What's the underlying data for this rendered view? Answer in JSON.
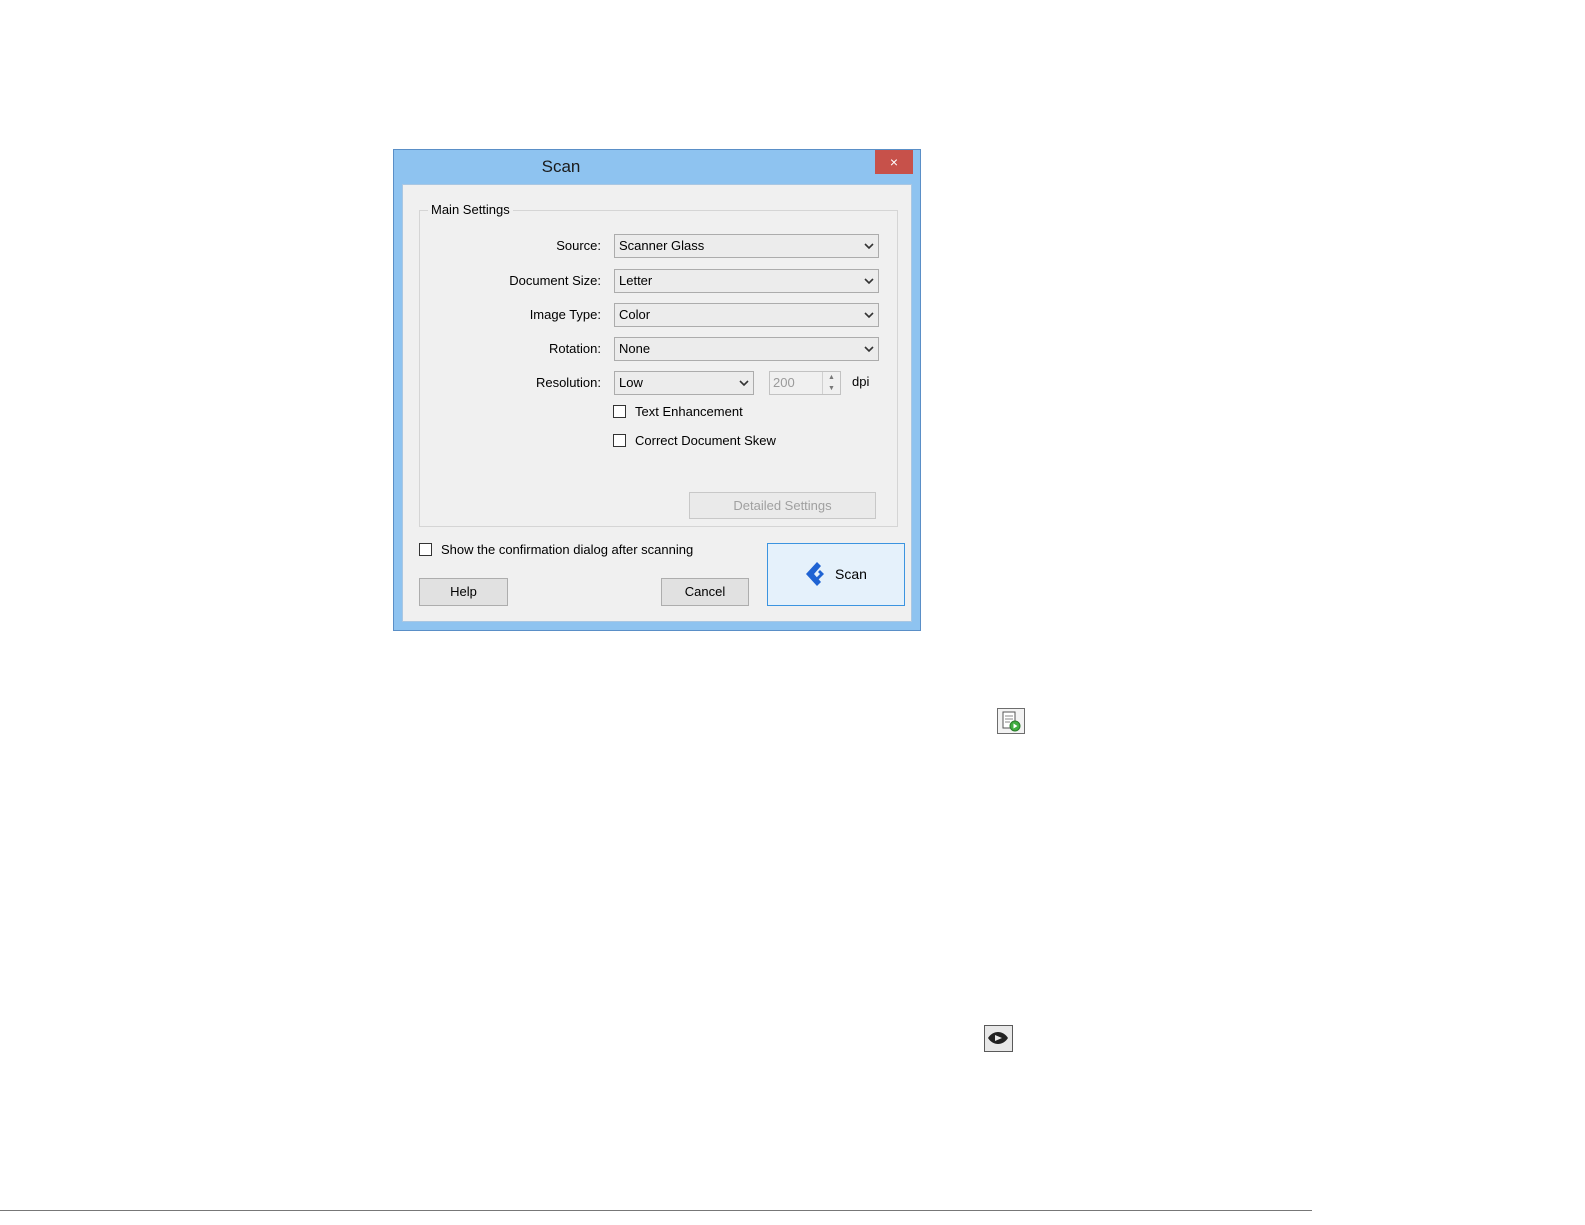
{
  "window": {
    "title": "Scan",
    "close_label": "×"
  },
  "main_settings": {
    "group_title": "Main Settings",
    "source": {
      "label": "Source:",
      "value": "Scanner Glass"
    },
    "document_size": {
      "label": "Document Size:",
      "value": "Letter"
    },
    "image_type": {
      "label": "Image Type:",
      "value": "Color"
    },
    "rotation": {
      "label": "Rotation:",
      "value": "None"
    },
    "resolution": {
      "label": "Resolution:",
      "value": "Low",
      "dpi_value": "200",
      "dpi_unit": "dpi"
    },
    "text_enhancement": {
      "label": "Text Enhancement",
      "checked": false
    },
    "correct_skew": {
      "label": "Correct Document Skew",
      "checked": false
    },
    "detailed_settings_label": "Detailed Settings"
  },
  "footer": {
    "confirm_label": "Show the confirmation dialog after scanning",
    "confirm_checked": false,
    "help_label": "Help",
    "cancel_label": "Cancel",
    "scan_label": "Scan"
  },
  "colors": {
    "title_bar": "#8ec3f0",
    "close_button": "#c7514a",
    "scan_accent": "#1f63d3"
  },
  "icons": [
    "close-icon",
    "chevron-down-icon",
    "scan-logo-icon",
    "document-scan-icon",
    "scan-arrow-icon"
  ]
}
